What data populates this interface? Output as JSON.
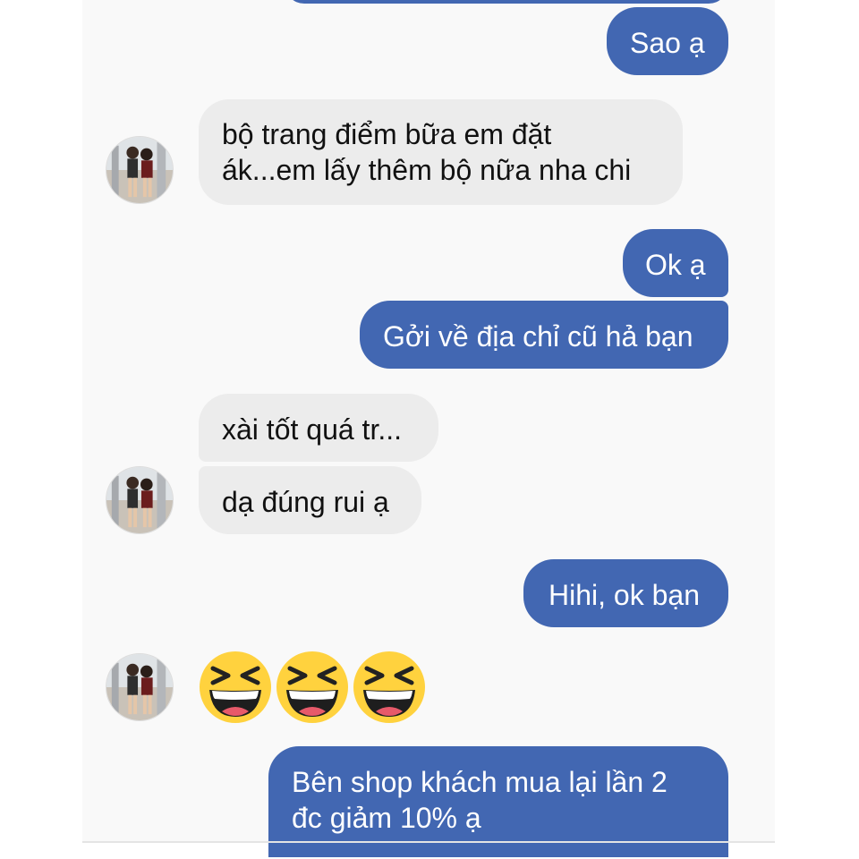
{
  "messages": [
    {
      "side": "out",
      "text": "Sao ạ"
    },
    {
      "side": "in",
      "lines": [
        "bộ trang điểm bữa em đặt",
        "ák...em lấy thêm bộ nữa nha chi"
      ]
    },
    {
      "side": "out",
      "text": "Ok ạ"
    },
    {
      "side": "out",
      "text": "Gởi về địa chỉ cũ hả bạn"
    },
    {
      "side": "in",
      "text": "xài tốt quá tr..."
    },
    {
      "side": "in",
      "text": "dạ đúng rui ạ"
    },
    {
      "side": "out",
      "text": "Hihi, ok bạn"
    },
    {
      "side": "in",
      "emoji": [
        "laughing-face-icon",
        "laughing-face-icon",
        "laughing-face-icon"
      ]
    },
    {
      "side": "out",
      "lines": [
        "Bên shop khách mua lại lần 2",
        "đc giảm 10% ạ"
      ]
    }
  ],
  "colors": {
    "outgoing_bubble": "#4267b2",
    "incoming_bubble": "#ececec",
    "emoji_face": "#ffd23e"
  }
}
